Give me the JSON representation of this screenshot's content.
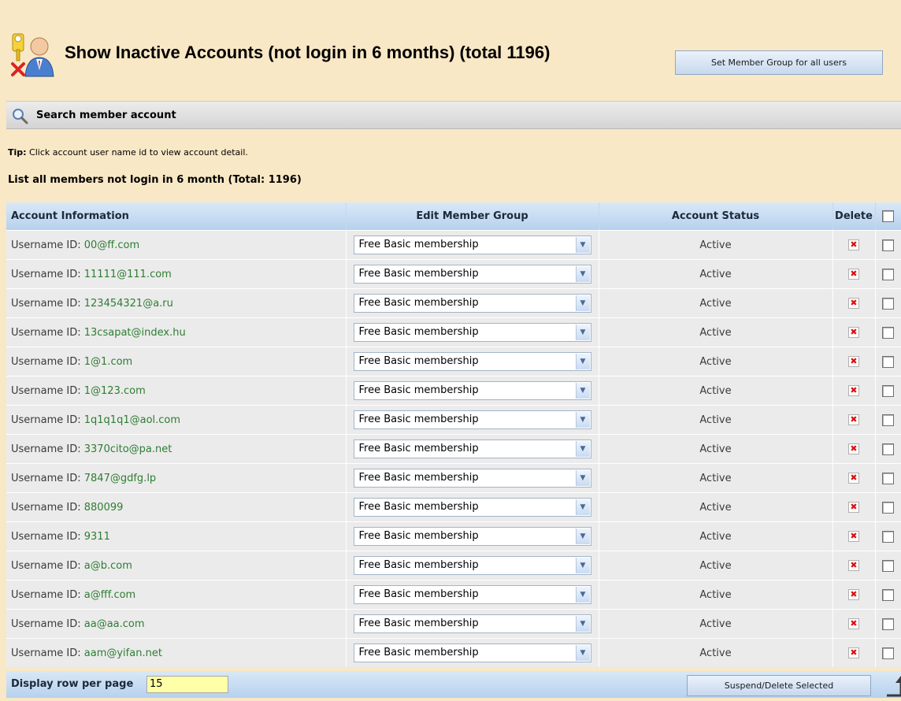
{
  "header": {
    "title": "Show Inactive Accounts (not login in 6 months) (total 1196)",
    "set_group_button": "Set Member Group for all users"
  },
  "search": {
    "label": "Search member account"
  },
  "tip": {
    "prefix": "Tip:",
    "text": "Click account user name id to view account detail."
  },
  "list_title": "List all members not login in 6 month (Total: 1196)",
  "table": {
    "headers": {
      "account": "Account Information",
      "group": "Edit Member Group",
      "status": "Account Status",
      "delete": "Delete"
    },
    "id_prefix": "Username ID: ",
    "rows": [
      {
        "id": "00@ff.com",
        "group": "Free Basic membership",
        "status": "Active"
      },
      {
        "id": "11111@111.com",
        "group": "Free Basic membership",
        "status": "Active"
      },
      {
        "id": "123454321@a.ru",
        "group": "Free Basic membership",
        "status": "Active"
      },
      {
        "id": "13csapat@index.hu",
        "group": "Free Basic membership",
        "status": "Active"
      },
      {
        "id": "1@1.com",
        "group": "Free Basic membership",
        "status": "Active"
      },
      {
        "id": "1@123.com",
        "group": "Free Basic membership",
        "status": "Active"
      },
      {
        "id": "1q1q1q1@aol.com",
        "group": "Free Basic membership",
        "status": "Active"
      },
      {
        "id": "3370cito@pa.net",
        "group": "Free Basic membership",
        "status": "Active"
      },
      {
        "id": "7847@gdfg.lp",
        "group": "Free Basic membership",
        "status": "Active"
      },
      {
        "id": "880099",
        "group": "Free Basic membership",
        "status": "Active"
      },
      {
        "id": "9311",
        "group": "Free Basic membership",
        "status": "Active"
      },
      {
        "id": "a@b.com",
        "group": "Free Basic membership",
        "status": "Active"
      },
      {
        "id": "a@fff.com",
        "group": "Free Basic membership",
        "status": "Active"
      },
      {
        "id": "aa@aa.com",
        "group": "Free Basic membership",
        "status": "Active"
      },
      {
        "id": "aam@yifan.net",
        "group": "Free Basic membership",
        "status": "Active"
      }
    ]
  },
  "footer": {
    "rows_label": "Display row per page",
    "rows_value": "15",
    "suspend_button": "Suspend/Delete Selected"
  },
  "icons": {
    "header": "inactive-users-icon",
    "search": "magnifier-icon",
    "delete": "red-x-icon",
    "scroll_top": "up-arrow-icon"
  },
  "colors": {
    "background": "#f9e8c5",
    "username_link": "#2e7d32",
    "header_gradient_top": "#d9e8f7",
    "header_gradient_bottom": "#b7d1ee",
    "rows_input_bg": "#ffffa8"
  }
}
